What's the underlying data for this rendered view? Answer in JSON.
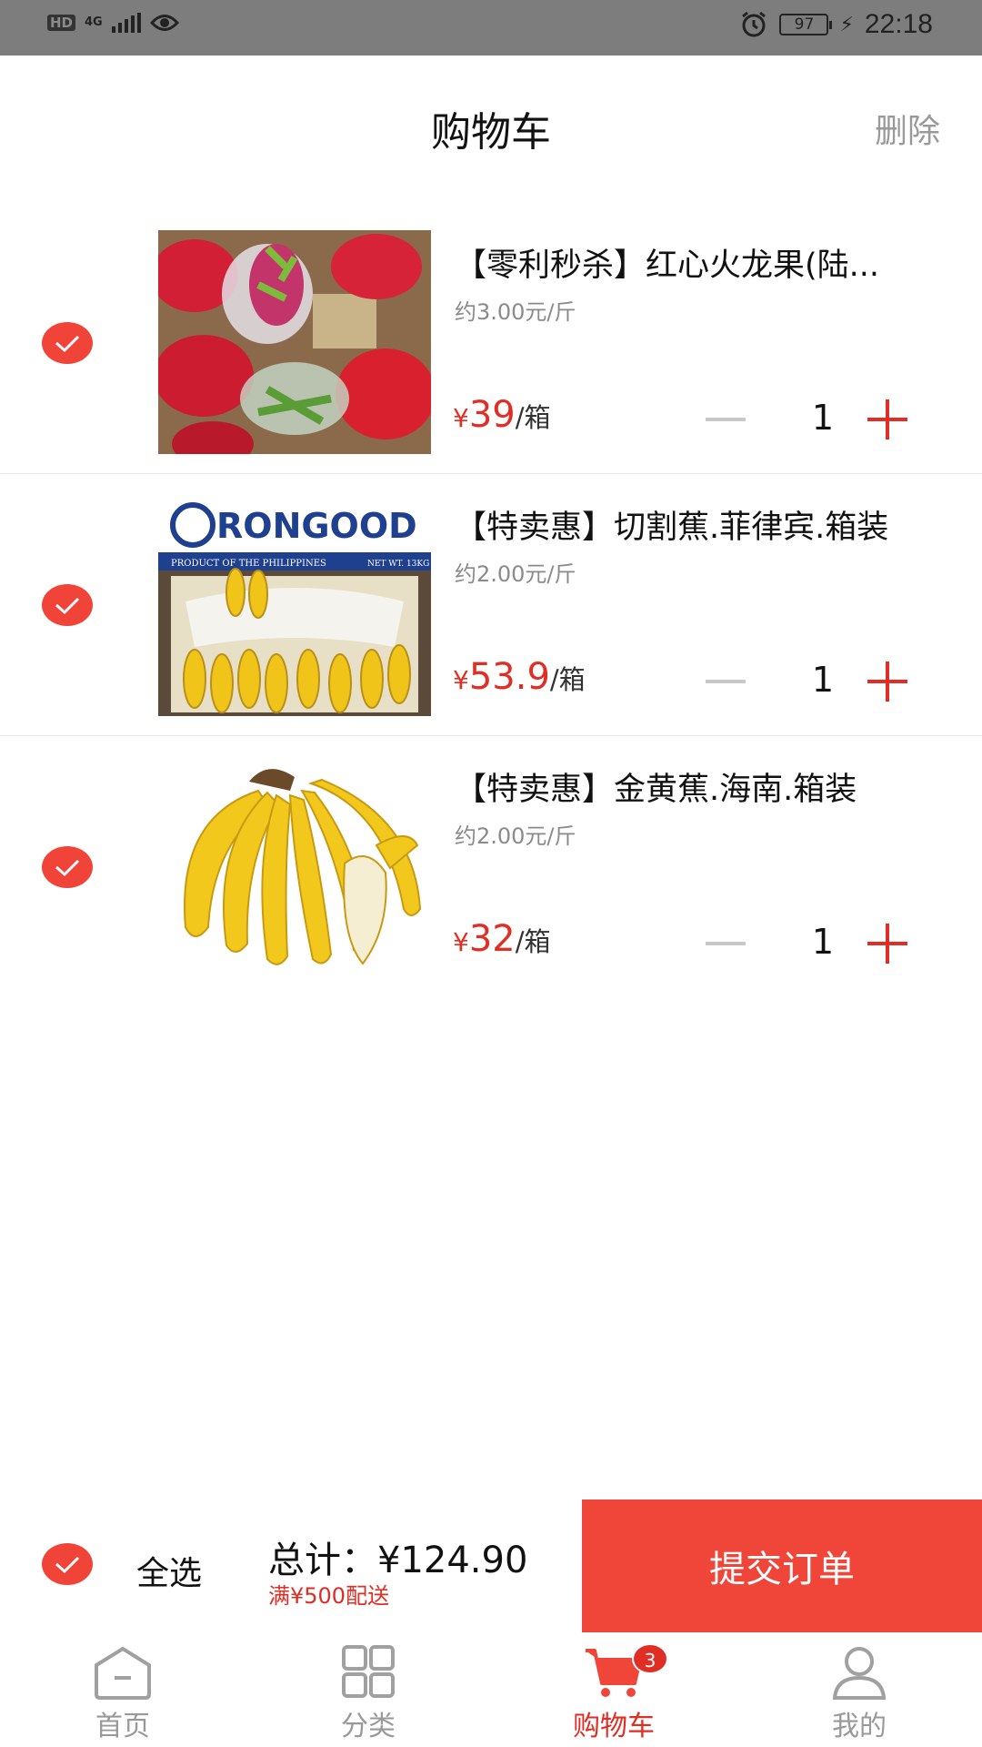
{
  "status_bar": {
    "hd": "HD",
    "network": "4G",
    "battery": "97",
    "time": "22:18"
  },
  "header": {
    "title": "购物车",
    "delete_label": "删除"
  },
  "cart": {
    "items": [
      {
        "name": "【零利秒杀】红心火龙果(陆...",
        "unit_price": "约3.00元/斤",
        "currency": "¥",
        "price": "39",
        "unit": "/箱",
        "quantity": "1",
        "selected": true,
        "image": "dragon-fruit-box"
      },
      {
        "name": "【特卖惠】切割蕉.菲律宾.箱装",
        "unit_price": "约2.00元/斤",
        "currency": "¥",
        "price": "53.9",
        "unit": "/箱",
        "quantity": "1",
        "selected": true,
        "image": "banana-box",
        "image_text": {
          "brand": "RONGOOD",
          "origin": "PRODUCT OF THE PHILIPPINES",
          "weight": "NET WT. 13KG"
        }
      },
      {
        "name": "【特卖惠】金黄蕉.海南.箱装",
        "unit_price": "约2.00元/斤",
        "currency": "¥",
        "price": "32",
        "unit": "/箱",
        "quantity": "1",
        "selected": true,
        "image": "banana-bunch"
      }
    ]
  },
  "summary": {
    "select_all_label": "全选",
    "total_label": "总计：¥124.90",
    "threshold_note": "满¥500配送",
    "submit_label": "提交订单"
  },
  "tabbar": {
    "items": [
      {
        "label": "首页",
        "icon": "home-icon"
      },
      {
        "label": "分类",
        "icon": "category-icon"
      },
      {
        "label": "购物车",
        "icon": "cart-icon",
        "active": true,
        "badge": "3"
      },
      {
        "label": "我的",
        "icon": "user-icon"
      }
    ]
  },
  "colors": {
    "accent": "#e02e24",
    "submit_bg": "#f0463a",
    "status_bar_bg": "#7d7d7d",
    "muted_text": "#999999"
  }
}
